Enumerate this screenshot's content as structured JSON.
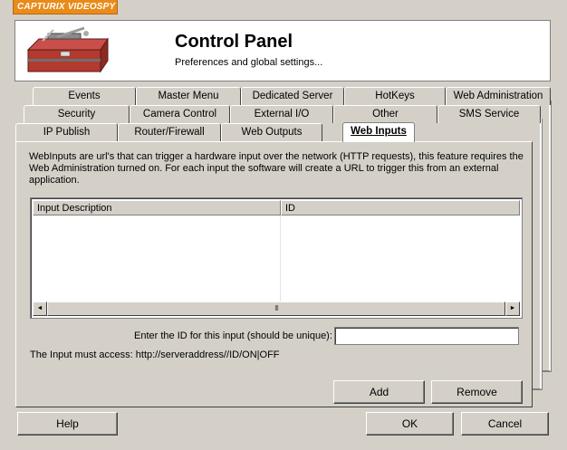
{
  "app": {
    "badge": "CAPTURIX VIDEOSPY"
  },
  "header": {
    "title": "Control Panel",
    "subtitle": "Preferences and global settings..."
  },
  "tabs": {
    "row3": [
      "Events",
      "Master Menu",
      "Dedicated Server",
      "HotKeys",
      "Web Administration"
    ],
    "row2": [
      "Security",
      "Camera Control",
      "External I/O",
      "Other",
      "SMS Service"
    ],
    "row1": [
      "IP Publish",
      "Router/Firewall",
      "Web Outputs",
      "Web Inputs"
    ],
    "active": "Web Inputs"
  },
  "panel": {
    "description": "WebInputs are url's that can trigger a hardware input over the network (HTTP requests), this feature requires the Web Administration turned on. For each input the software will create a URL to trigger this from an external application.",
    "list": {
      "columns": [
        "Input Description",
        "ID"
      ],
      "rows": [],
      "scroll_left_glyph": "◄",
      "scroll_right_glyph": "►",
      "thumb_grip": "III"
    },
    "id_label": "Enter the ID for this input (should be unique):",
    "id_value": "",
    "access_text": "The Input must access: http://serveraddress//ID/ON|OFF",
    "add_label": "Add",
    "remove_label": "Remove"
  },
  "footer": {
    "help_label": "Help",
    "ok_label": "OK",
    "cancel_label": "Cancel"
  },
  "colors": {
    "badge": "#e98b1a",
    "dialog_face": "#d4d0c8",
    "white": "#ffffff"
  },
  "icons": {
    "logo": "toolbox-icon"
  }
}
